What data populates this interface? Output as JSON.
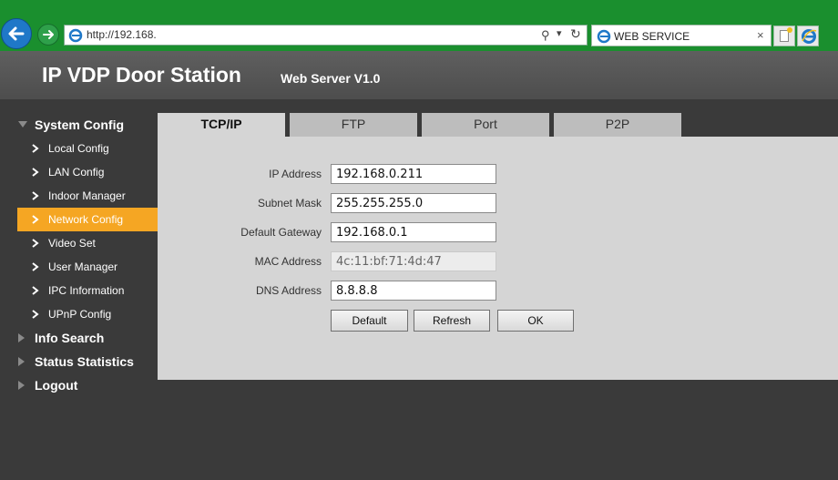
{
  "browser": {
    "address": "http://192.168.",
    "tab_title": "WEB SERVICE",
    "tab_close": "×"
  },
  "header": {
    "title": "IP VDP Door Station",
    "subtitle": "Web Server V1.0"
  },
  "sidebar": {
    "system_config": "System Config",
    "items": [
      {
        "label": "Local Config"
      },
      {
        "label": "LAN Config"
      },
      {
        "label": "Indoor Manager"
      },
      {
        "label": "Network Config"
      },
      {
        "label": "Video Set"
      },
      {
        "label": "User Manager"
      },
      {
        "label": "IPC Information"
      },
      {
        "label": "UPnP Config"
      }
    ],
    "info_search": "Info Search",
    "status_statistics": "Status Statistics",
    "logout": "Logout"
  },
  "tabs": [
    {
      "label": "TCP/IP"
    },
    {
      "label": "FTP"
    },
    {
      "label": "Port"
    },
    {
      "label": "P2P"
    }
  ],
  "form": {
    "ip_label": "IP Address",
    "ip_value": "192.168.0.211",
    "mask_label": "Subnet Mask",
    "mask_value": "255.255.255.0",
    "gateway_label": "Default Gateway",
    "gateway_value": "192.168.0.1",
    "mac_label": "MAC Address",
    "mac_value": "4c:11:bf:71:4d:47",
    "dns_label": "DNS Address",
    "dns_value": "8.8.8.8"
  },
  "buttons": {
    "default": "Default",
    "refresh": "Refresh",
    "ok": "OK"
  },
  "colors": {
    "accent": "#f5a623",
    "chrome": "#1a8f2e",
    "header": "#555555",
    "sidebar": "#3a3a3a",
    "panel": "#d5d5d5"
  }
}
